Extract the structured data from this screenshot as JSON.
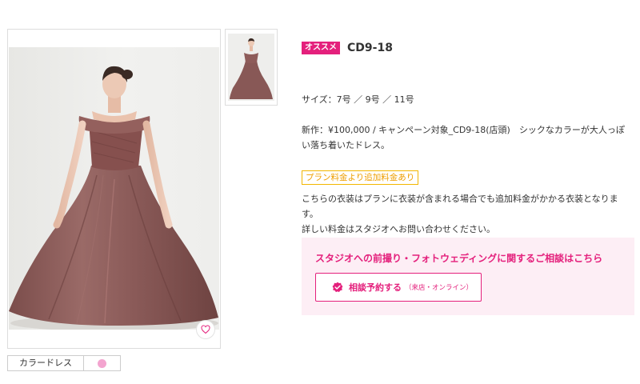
{
  "product": {
    "badge": "オススメ",
    "code": "CD9-18",
    "size": "サイズ：7号 ／ 9号 ／ 11号",
    "description": "新作：¥100,000 / キャンペーン対象_CD9-18(店頭)　シックなカラーが大人っぽい落ち着いたドレス。",
    "plan_badge": "プラン料金より追加料金あり",
    "note_line1": "こちらの衣装はプランに衣装が含まれる場合でも追加料金がかかる衣装となります。",
    "note_line2": "詳しい料金はスタジオへお問い合わせください。"
  },
  "gallery": {
    "category_label": "カラードレス",
    "swatch_color": "#f3a4cf",
    "favorite_icon": "heart-icon"
  },
  "consult": {
    "title": "スタジオへの前撮り・フォトウェディングに関するご相談はこちら",
    "button_label": "相談予約する",
    "button_sub": "（来店・オンライン）",
    "button_icon": "check-badge-icon"
  },
  "colors": {
    "accent_pink": "#e4207c",
    "consult_bg": "#fdeef5",
    "plan_border": "#f2b600",
    "dress": "#8a5a58"
  }
}
